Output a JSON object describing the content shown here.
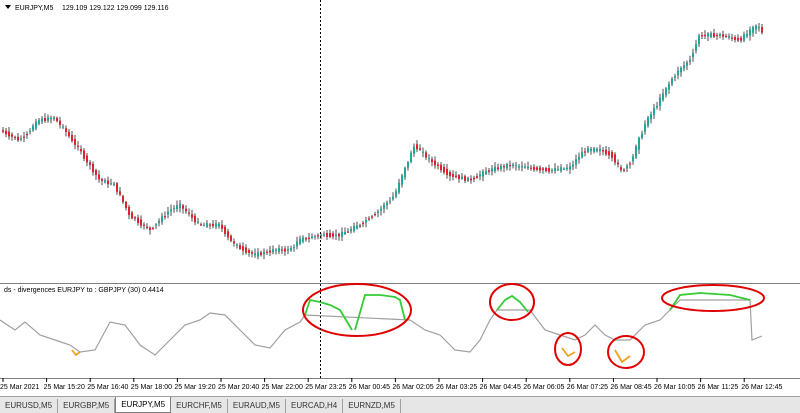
{
  "main_chart": {
    "symbol_label": "EURJPY,M5",
    "ohlc_values": "129.109 129.122 129.099 129.116"
  },
  "indicator": {
    "label": "ds - divergences EURJPY to : GBPJPY (30) 0.4414"
  },
  "time_axis": {
    "labels": [
      "25 Mar 2021",
      "25 Mar 15:20",
      "25 Mar 16:40",
      "25 Mar 18:00",
      "25 Mar 19:20",
      "25 Mar 20:40",
      "25 Mar 22:00",
      "25 Mar 23:25",
      "26 Mar 00:45",
      "26 Mar 02:05",
      "26 Mar 03:25",
      "26 Mar 04:45",
      "26 Mar 06:05",
      "26 Mar 07:25",
      "26 Mar 08:45",
      "26 Mar 10:05",
      "26 Mar 11:25",
      "26 Mar 12:45"
    ]
  },
  "tabs": [
    {
      "label": "EURUSD,M5",
      "active": false
    },
    {
      "label": "EURGBP,M5",
      "active": false
    },
    {
      "label": "EURJPY,M5",
      "active": true
    },
    {
      "label": "EURCHF,M5",
      "active": false
    },
    {
      "label": "EURAUD,M5",
      "active": false
    },
    {
      "label": "EURCAD,H4",
      "active": false
    },
    {
      "label": "EURNZD,M5",
      "active": false
    }
  ],
  "colors": {
    "bull_candle": "#26a69a",
    "bear_candle": "#e0212f",
    "indicator_line": "#a0a0a0",
    "bull_divergence": "#33cc33",
    "bear_divergence": "#f0a020",
    "highlight_ellipse": "#e00000",
    "crosshair": "#000000"
  },
  "icons": [
    "dropdown-arrow-icon"
  ]
}
